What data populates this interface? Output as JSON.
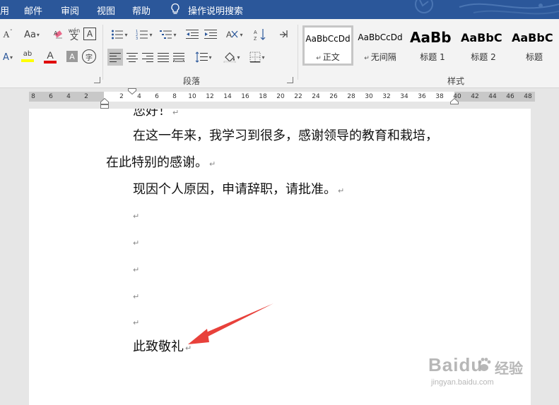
{
  "ribbon_tabs": [
    {
      "label": "用"
    },
    {
      "label": "邮件"
    },
    {
      "label": "审阅"
    },
    {
      "label": "视图"
    },
    {
      "label": "帮助"
    }
  ],
  "tell_me": "操作说明搜索",
  "groups": {
    "paragraph": "段落",
    "styles": "样式"
  },
  "font_controls": {
    "case_label": "Aa",
    "phonetic_top": "wén",
    "phonetic_bottom": "文",
    "border_char": "A",
    "shade_char": "A",
    "enclose_char": "字",
    "highlight_label": "ab",
    "font_color_label": "A"
  },
  "styles": [
    {
      "preview": "AaBbCcDd",
      "name": "正文"
    },
    {
      "preview": "AaBbCcDd",
      "name": "无间隔"
    },
    {
      "preview": "AaBb",
      "name": "标题 1"
    },
    {
      "preview": "AaBbC",
      "name": "标题 2"
    },
    {
      "preview": "AaBbC",
      "name": "标题"
    }
  ],
  "ruler_numbers": [
    "8",
    "6",
    "4",
    "2",
    "2",
    "4",
    "6",
    "8",
    "10",
    "12",
    "14",
    "16",
    "18",
    "20",
    "22",
    "24",
    "26",
    "28",
    "30",
    "32",
    "34",
    "36",
    "38",
    "40",
    "42",
    "44",
    "46",
    "48"
  ],
  "document": {
    "line_top": "您好！",
    "line1": "在这一年来，我学习到很多，感谢领导的教育和栽培，",
    "line2": "在此特别的感谢。",
    "line3": "现因个人原因，申请辞职，请批准。",
    "empty_mark": "↵",
    "closing": "此致敬礼"
  },
  "watermark": {
    "brand": "Baidu",
    "brand_cn": "经验",
    "url": "jingyan.baidu.com"
  },
  "colors": {
    "ribbon_blue": "#2b579a",
    "highlight_yellow": "#ffff00",
    "font_red": "#e00000",
    "annotation_arrow": "#e8413b"
  }
}
